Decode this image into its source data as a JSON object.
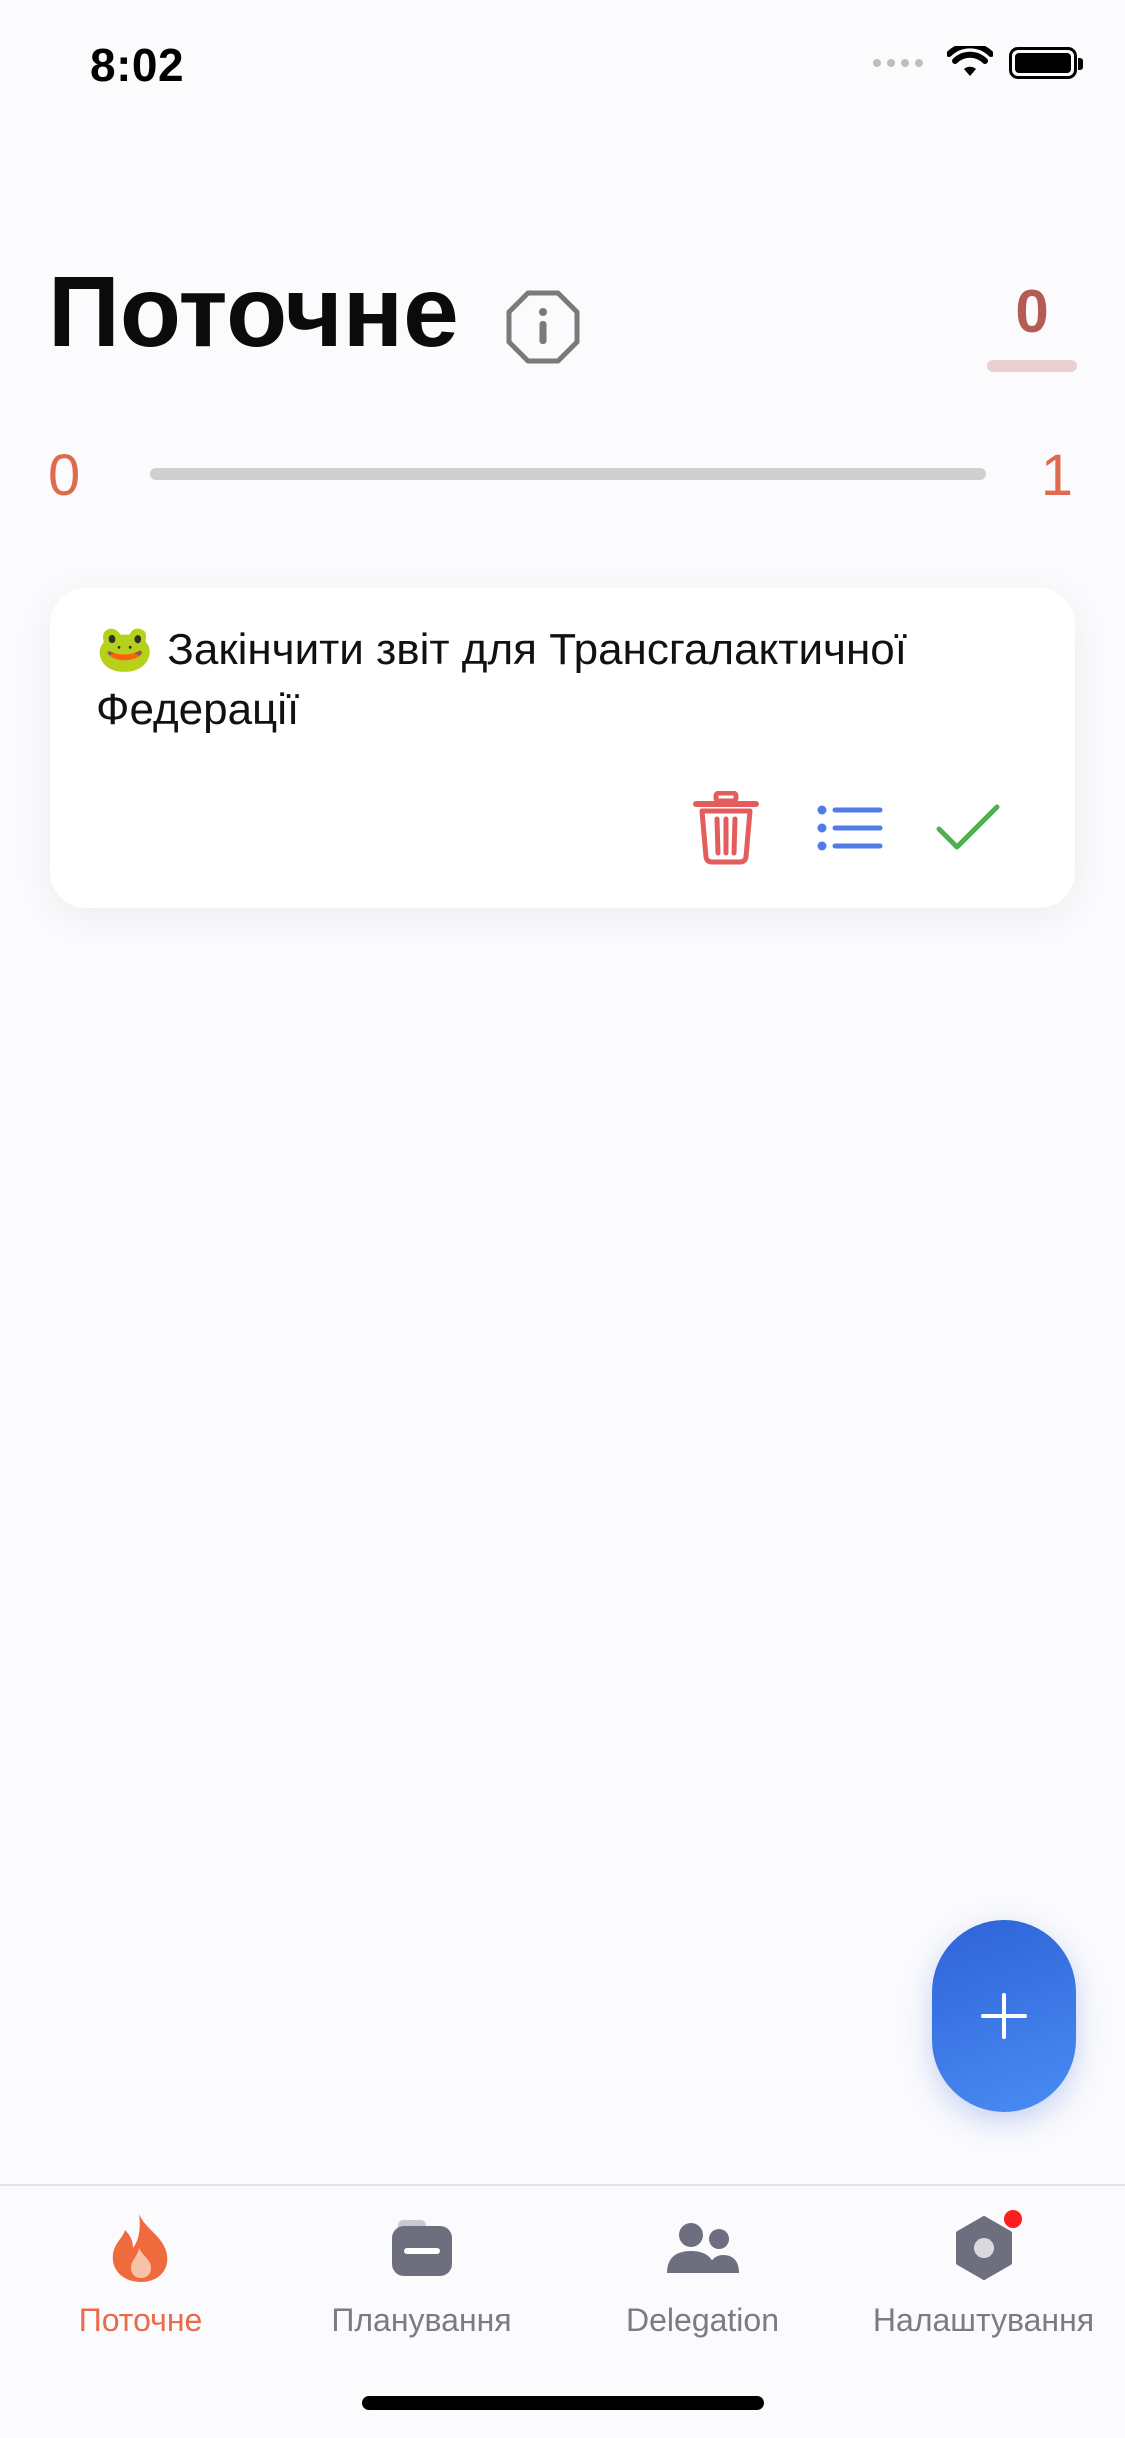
{
  "status_bar": {
    "time": "8:02"
  },
  "header": {
    "title": "Поточне",
    "score": "0"
  },
  "progress": {
    "min": "0",
    "max": "1",
    "value": 0
  },
  "task": {
    "emoji": "🐸",
    "text": "Закінчити звіт для Трансгалактичної Федерації"
  },
  "icons": {
    "info": "info-icon",
    "delete": "trash-icon",
    "details": "list-icon",
    "complete": "checkmark-icon",
    "add": "plus-icon"
  },
  "colors": {
    "accent": "#ea6a4a",
    "score": "#b55b53",
    "delete": "#e35d5d",
    "details": "#4f7ce8",
    "complete": "#4caf50",
    "fab": "#3a75e6"
  },
  "tabs": [
    {
      "label": "Поточне",
      "icon": "flame-icon",
      "active": true
    },
    {
      "label": "Планування",
      "icon": "folder-icon",
      "active": false
    },
    {
      "label": "Delegation",
      "icon": "people-icon",
      "active": false
    },
    {
      "label": "Налаштування",
      "icon": "settings-icon",
      "active": false,
      "badge": true
    }
  ]
}
